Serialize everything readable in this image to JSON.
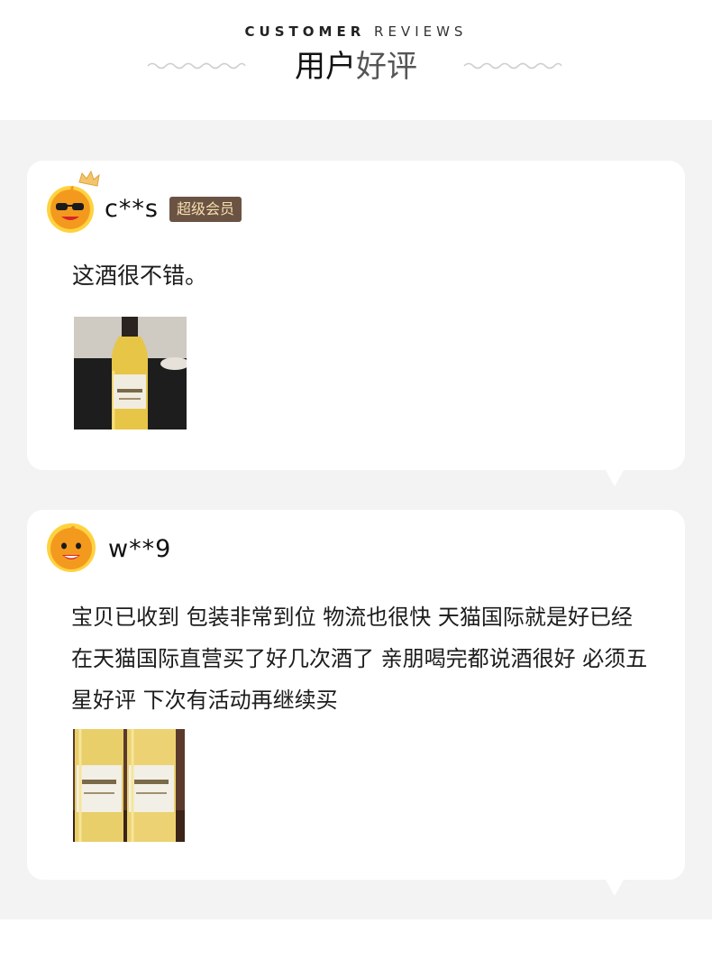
{
  "header": {
    "eyebrow_bold": "CUSTOMER",
    "eyebrow_light": "REVIEWS",
    "title_dark": "用户",
    "title_light": "好评"
  },
  "reviews": [
    {
      "username": "c**s",
      "badge": "超级会员",
      "text": "这酒很不错。",
      "avatar_icon": "mascot-sunglasses-crown-icon",
      "photo": "single-white-wine-bottle-photo"
    },
    {
      "username": "w**9",
      "text": "宝贝已收到 包装非常到位 物流也很快 天猫国际就是好已经在天猫国际直营买了好几次酒了 亲朋喝完都说酒很好 必须五星好评 下次有活动再继续买",
      "avatar_icon": "mascot-smile-icon",
      "photo": "two-white-wine-bottles-photo"
    }
  ],
  "colors": {
    "panel_bg": "#f3f3f3",
    "card_bg": "#ffffff",
    "badge_bg": "#6b5344",
    "badge_text": "#f7dfb0",
    "avatar_orange": "#f39a1e"
  }
}
